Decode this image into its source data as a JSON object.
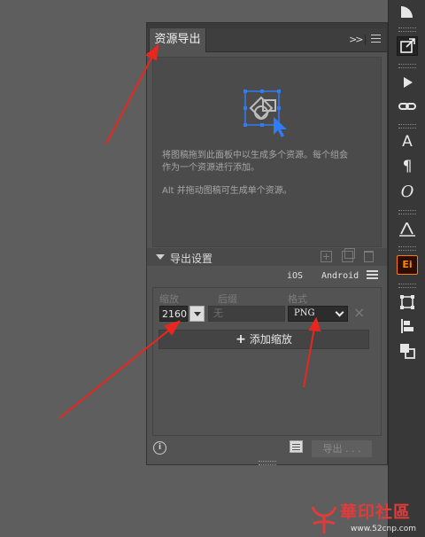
{
  "panel": {
    "tab_title": "资源导出",
    "collapse_glyph": ">>",
    "drop_hint_line1": "将图稿拖到此面板中以生成多个资源。每个组会",
    "drop_hint_line2": "作为一个资源进行添加。",
    "drop_hint_line3": "Alt 并拖动图稿可生成单个资源。"
  },
  "export_settings": {
    "title": "导出设置",
    "platform_ios": "iOS",
    "platform_android": "Android",
    "columns": {
      "scale": "缩放",
      "suffix": "后缀",
      "format": "格式"
    },
    "row": {
      "scale": "2160",
      "suffix_placeholder": "无",
      "format": "PNG"
    },
    "add_scale_label": "添加缩放",
    "export_button": "导出 . . ."
  },
  "toolbar": {
    "ei_label": "Ei",
    "char_label": "A",
    "para_label": "¶",
    "opentype_label": "O"
  },
  "watermark": {
    "brand": "華印社區",
    "url": "www.52cnp.com"
  },
  "colors": {
    "arrow": "#e8271f",
    "ei_accent": "#ff7c00",
    "selection_blue": "#2f7cf6"
  }
}
